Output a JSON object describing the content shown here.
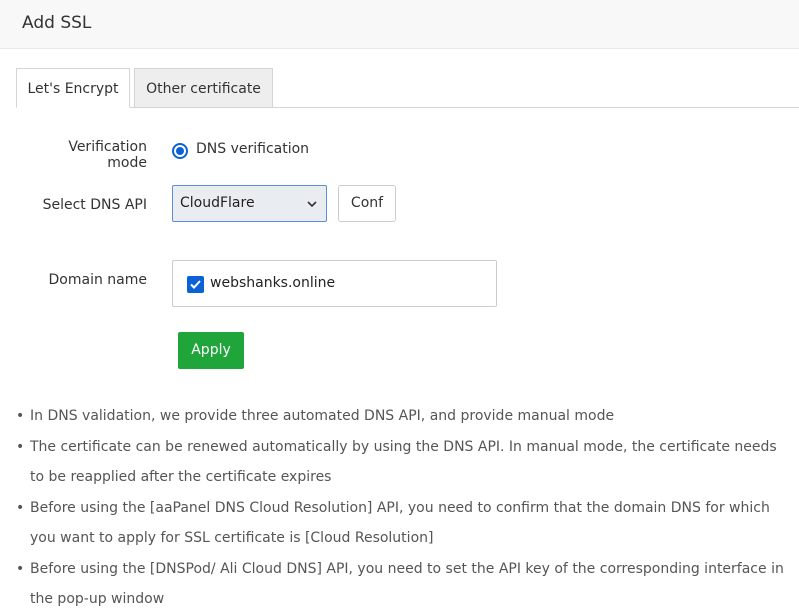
{
  "dialog": {
    "title": "Add SSL"
  },
  "tabs": [
    {
      "label": "Let's Encrypt",
      "active": true
    },
    {
      "label": "Other certificate",
      "active": false
    }
  ],
  "form": {
    "verification_mode": {
      "label": "Verification mode",
      "option": "DNS verification",
      "selected": true
    },
    "dns_api": {
      "label": "Select DNS API",
      "selected_value": "CloudFlare",
      "conf_button": "Conf"
    },
    "domain": {
      "label": "Domain name",
      "value": "webshanks.online",
      "checked": true
    },
    "apply_button": "Apply"
  },
  "notes": [
    "In DNS validation, we provide three automated DNS API, and provide manual mode",
    "The certificate can be renewed automatically by using the DNS API. In manual mode, the certificate needs to be reapplied after the certificate expires",
    "Before using the [aaPanel DNS Cloud Resolution] API, you need to confirm that the domain DNS for which you want to apply for SSL certificate is [Cloud Resolution]",
    "Before using the [DNSPod/ Ali Cloud DNS] API, you need to set the API key of the corresponding interface in the pop-up window"
  ],
  "colors": {
    "accent": "#0a62d6",
    "apply": "#20a53a"
  },
  "icons": {
    "select_arrow": "chevron-down-icon",
    "checkbox": "checkmark-icon"
  }
}
